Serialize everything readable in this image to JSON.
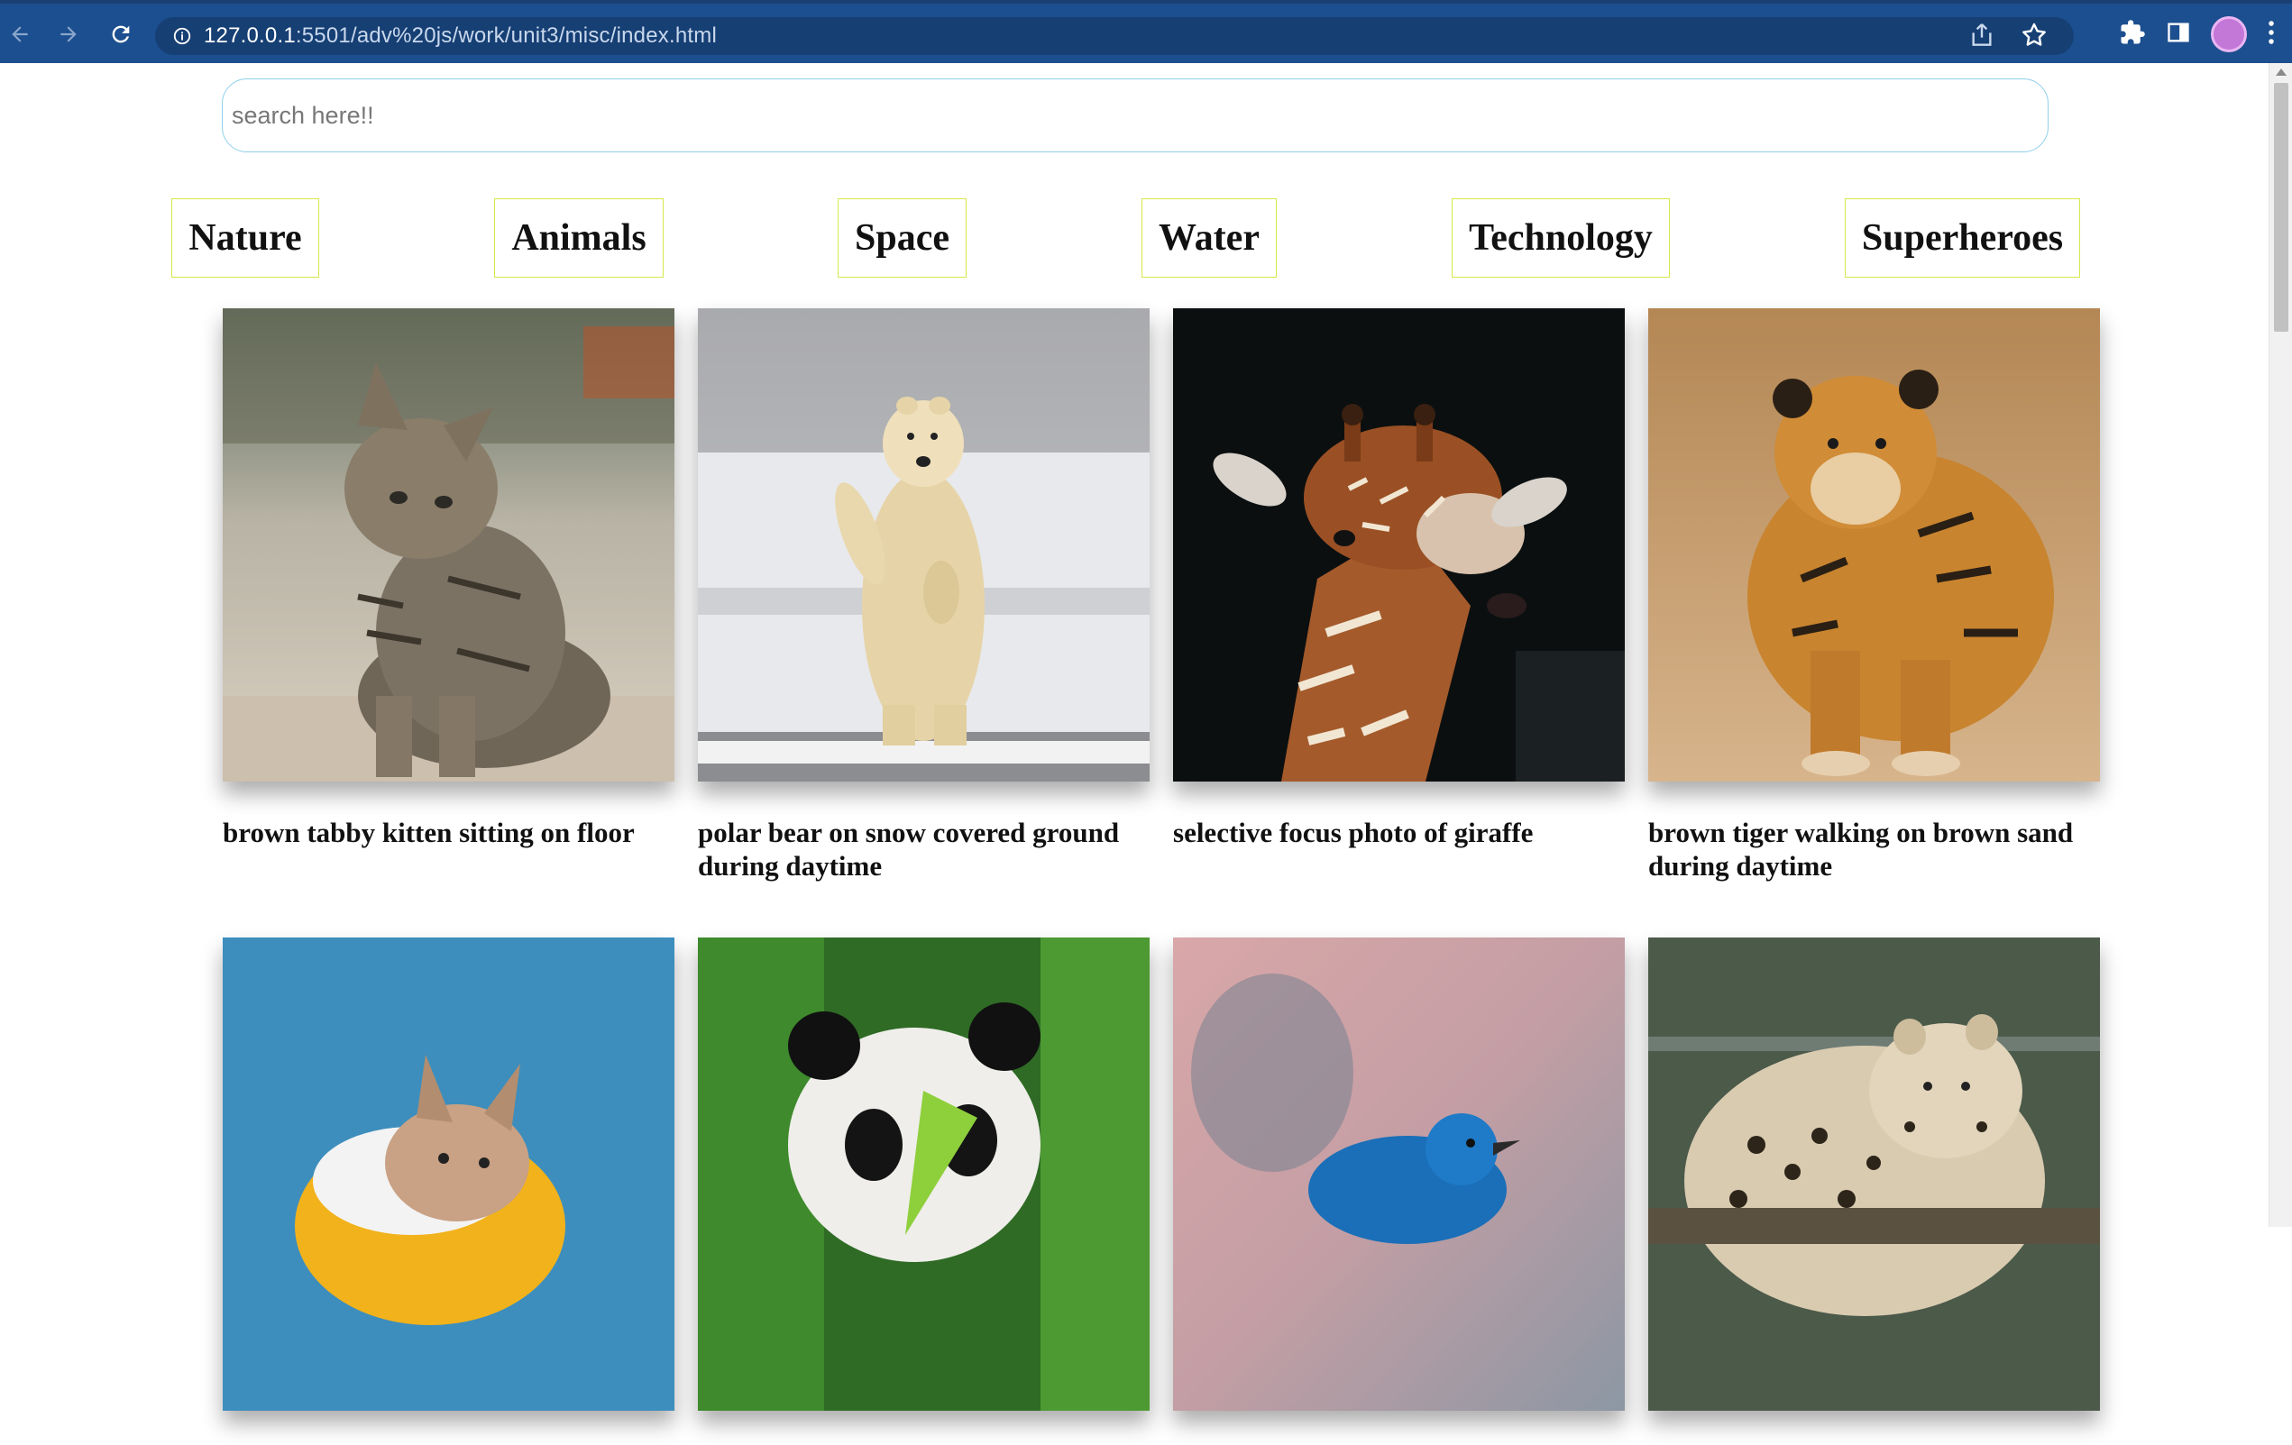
{
  "browser": {
    "url_host": "127.0.0.1",
    "url_path": ":5501/adv%20js/work/unit3/misc/index.html",
    "icons": [
      "back-icon",
      "forward-icon",
      "reload-icon",
      "site-info-icon",
      "share-icon",
      "bookmark-star-icon",
      "extensions-icon",
      "side-panel-icon",
      "profile-avatar",
      "menu-dots-icon"
    ]
  },
  "search": {
    "placeholder": "search here!!",
    "value": ""
  },
  "categories": [
    {
      "label": "Nature"
    },
    {
      "label": "Animals"
    },
    {
      "label": "Space"
    },
    {
      "label": "Water"
    },
    {
      "label": "Technology"
    },
    {
      "label": "Superheroes"
    }
  ],
  "gallery": {
    "row1": [
      {
        "caption": "brown tabby kitten sitting on floor"
      },
      {
        "caption": "polar bear on snow covered ground during daytime"
      },
      {
        "caption": "selective focus photo of giraffe"
      },
      {
        "caption": "brown tiger walking on brown sand during daytime"
      }
    ],
    "row2": [
      {
        "caption": ""
      },
      {
        "caption": ""
      },
      {
        "caption": ""
      },
      {
        "caption": ""
      }
    ]
  },
  "colors": {
    "chrome_bar": "#1c4f8f",
    "omnibox": "#163f74",
    "search_border": "#8fd0ea",
    "category_border": "#d6e84a"
  }
}
